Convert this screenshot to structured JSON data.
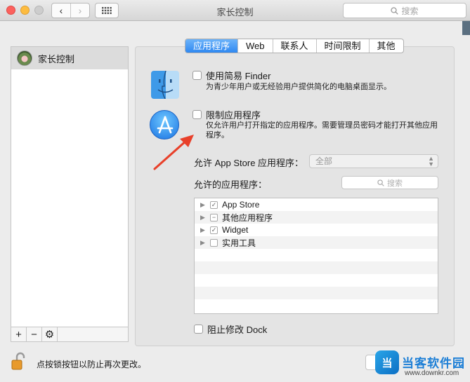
{
  "window": {
    "title": "家长控制"
  },
  "toolbar": {
    "back": "‹",
    "forward": "›",
    "search_placeholder": "搜索"
  },
  "sidebar": {
    "users": [
      {
        "name": "家长控制"
      }
    ],
    "footer": {
      "add": "+",
      "remove": "−",
      "gear": "⚙"
    }
  },
  "tabs": [
    {
      "label": "应用程序",
      "active": true
    },
    {
      "label": "Web"
    },
    {
      "label": "联系人"
    },
    {
      "label": "时间限制"
    },
    {
      "label": "其他"
    }
  ],
  "simple_finder": {
    "label": "使用简易 Finder",
    "desc": "为青少年用户或无经验用户提供简化的电脑桌面显示。",
    "checked": false
  },
  "limit_apps": {
    "label": "限制应用程序",
    "desc_line1": "仅允许用户打开指定的应用程序。需要管理员密码才能打开其他应用",
    "desc_line2": "程序。",
    "checked": false
  },
  "appstore_allow": {
    "label": "允许 App Store 应用程序：",
    "value": "全部"
  },
  "allowed_apps": {
    "label": "允许的应用程序：",
    "search_placeholder": "搜索",
    "items": [
      {
        "name": "App Store",
        "state": "✓"
      },
      {
        "name": "其他应用程序",
        "state": "−"
      },
      {
        "name": "Widget",
        "state": "✓"
      },
      {
        "name": "实用工具",
        "state": ""
      }
    ]
  },
  "dock": {
    "label": "阻止修改 Dock",
    "checked": false
  },
  "lock": {
    "text": "点按锁按钮以防止再次更改。"
  },
  "watermark": {
    "title": "当客软件园",
    "url": "www.downkr.com"
  },
  "colors": {
    "accent": "#2f88f1",
    "arrow": "#e8402a"
  }
}
